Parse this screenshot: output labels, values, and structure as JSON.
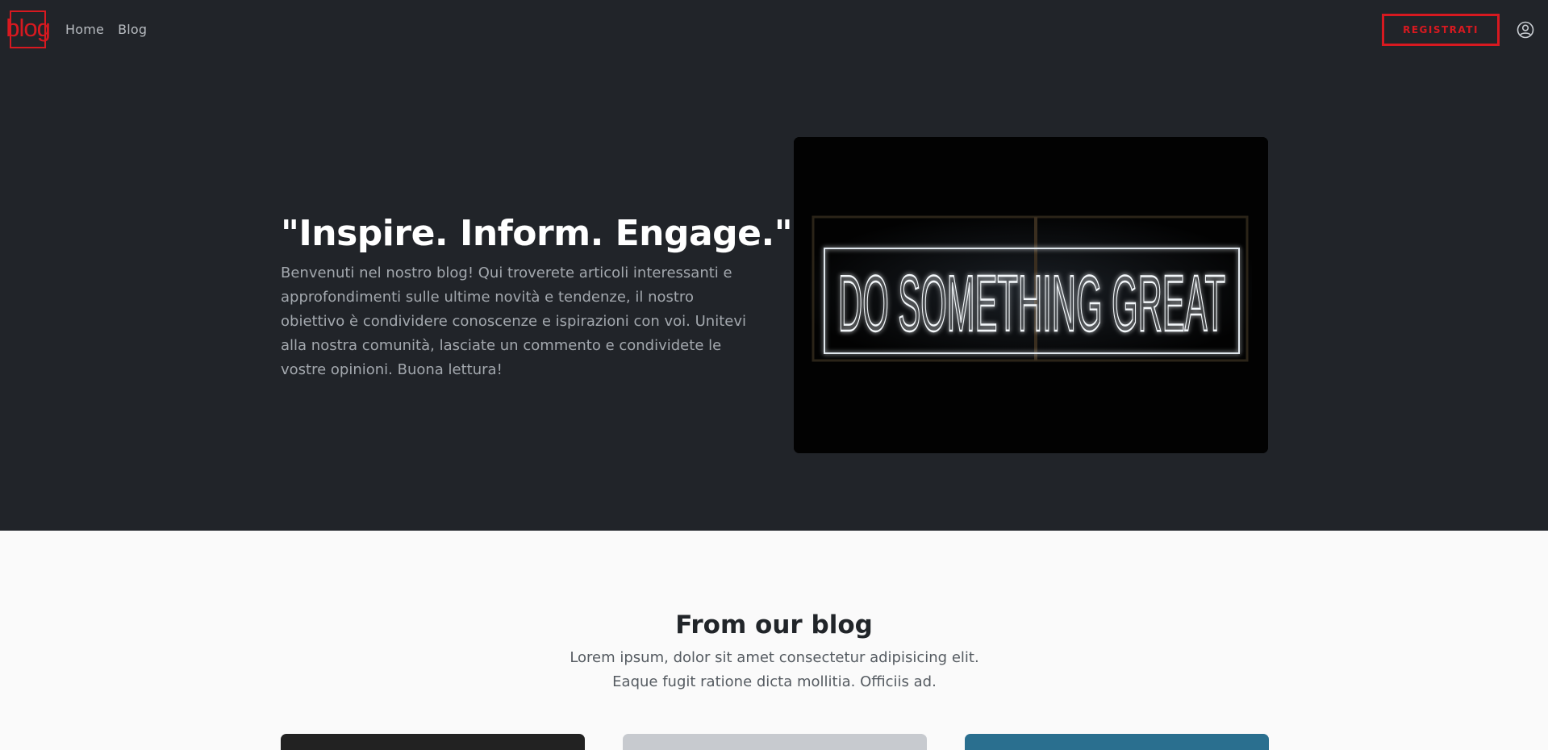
{
  "nav": {
    "logo_text": "blog",
    "links": [
      {
        "label": "Home"
      },
      {
        "label": "Blog"
      }
    ],
    "register_label": "REGISTRATI",
    "accent_color": "#d71920"
  },
  "hero": {
    "title": "\"Inspire. Inform. Engage.\"",
    "description": "Benvenuti nel nostro blog! Qui troverete articoli interessanti e approfondimenti sulle ultime novità e tendenze, il nostro obiettivo è condividere conoscenze e ispirazioni con voi. Unitevi alla nostra comunità, lasciate un commento e condividete le vostre opinioni. Buona lettura!",
    "image_neon_text": "DO SOMETHING GREAT"
  },
  "blog": {
    "title": "From our blog",
    "subtitle": "Lorem ipsum, dolor sit amet consectetur adipisicing elit. Eaque fugit ratione dicta mollitia. Officiis ad."
  }
}
